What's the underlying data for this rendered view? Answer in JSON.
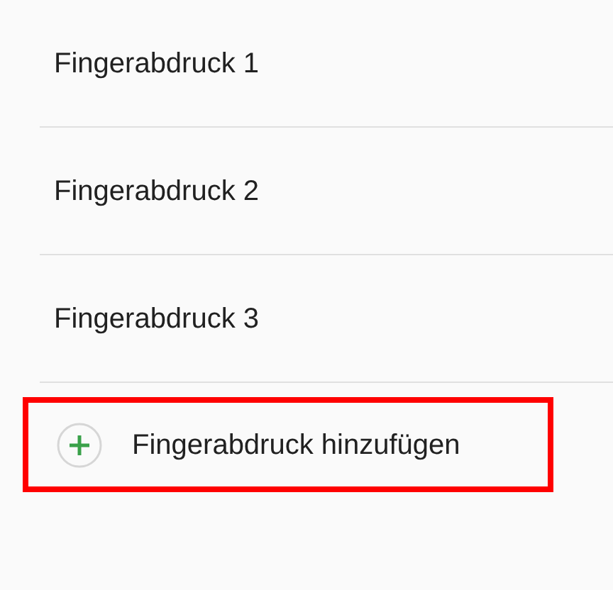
{
  "fingerprints": [
    {
      "label": "Fingerabdruck 1"
    },
    {
      "label": "Fingerabdruck 2"
    },
    {
      "label": "Fingerabdruck 3"
    }
  ],
  "add_action": {
    "label": "Fingerabdruck hinzufügen",
    "highlighted": true
  }
}
